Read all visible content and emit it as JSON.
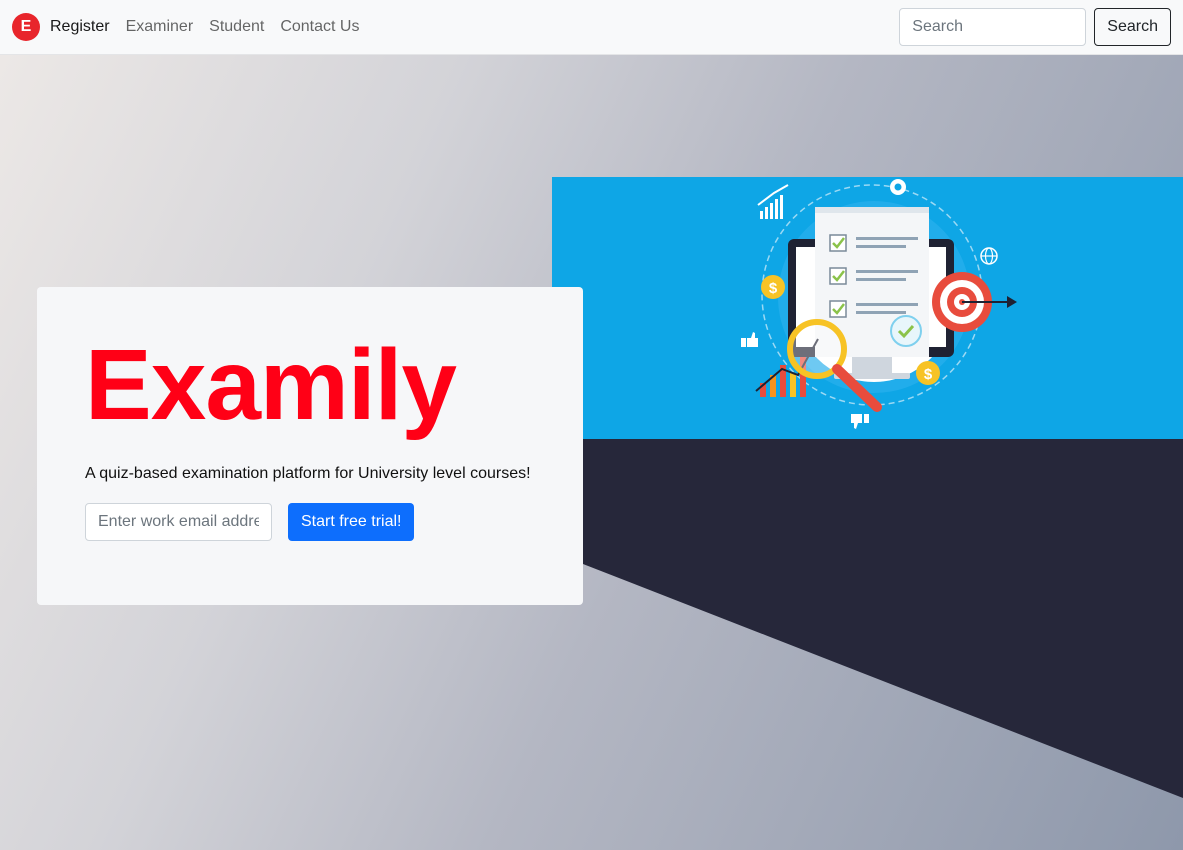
{
  "navbar": {
    "logo_letter": "E",
    "links": [
      {
        "label": "Register"
      },
      {
        "label": "Examiner"
      },
      {
        "label": "Student"
      },
      {
        "label": "Contact Us"
      }
    ],
    "search": {
      "placeholder": "Search",
      "button_label": "Search"
    }
  },
  "hero": {
    "title": "Examily",
    "tagline": "A quiz-based examination platform for University level courses!",
    "email_placeholder": "Enter work email address",
    "cta_label": "Start free trial!"
  },
  "banner": {
    "icons": [
      "chart-icon",
      "gear-icon",
      "globe-icon",
      "coin-icon",
      "target-icon",
      "checklist-icon",
      "magnifier-icon",
      "thumbs-up-icon",
      "thumbs-down-icon"
    ]
  },
  "colors": {
    "brand_red": "#ff0016",
    "primary_blue": "#0d6efd",
    "banner_blue": "#0ea6e6",
    "dark_navy": "#26273a"
  }
}
